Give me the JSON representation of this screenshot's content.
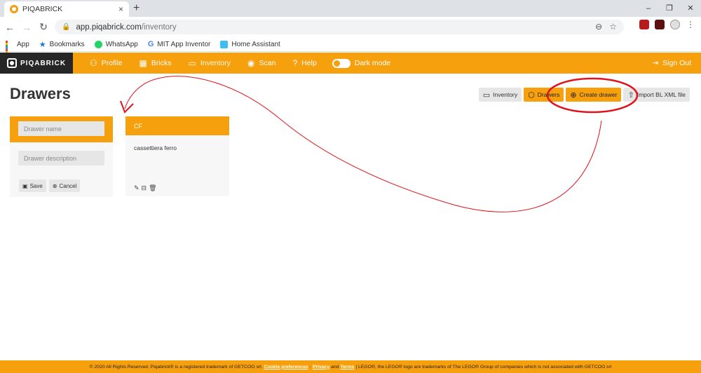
{
  "browser": {
    "tab_title": "PIQABRICK",
    "tab_close": "×",
    "new_tab": "+",
    "window_controls": [
      "–",
      "❐",
      "✕"
    ],
    "url_host": "app.piqabrick.com",
    "url_path": "/inventory",
    "bookmarks": [
      {
        "label": "App",
        "icon": "apps-grid-icon"
      },
      {
        "label": "Bookmarks",
        "icon": "star-icon"
      },
      {
        "label": "WhatsApp",
        "icon": "whatsapp-icon"
      },
      {
        "label": "MIT App Inventor",
        "icon": "google-icon"
      },
      {
        "label": "Home Assistant",
        "icon": "home-assistant-icon"
      }
    ]
  },
  "nav": {
    "brand": "PIQABRICK",
    "items": [
      {
        "label": "Profile",
        "icon": "user-icon",
        "glyph": "⚇"
      },
      {
        "label": "Bricks",
        "icon": "bricks-grid-icon",
        "glyph": "▦"
      },
      {
        "label": "Inventory",
        "icon": "inventory-box-icon",
        "glyph": "▭"
      },
      {
        "label": "Scan",
        "icon": "eye-icon",
        "glyph": "◉"
      },
      {
        "label": "Help",
        "icon": "help-icon",
        "glyph": "?"
      }
    ],
    "dark_mode_label": "Dark mode",
    "sign_out": "Sign Out"
  },
  "page": {
    "title": "Drawers",
    "actions": [
      {
        "label": "Inventory",
        "icon": "inventory-box-icon",
        "style": "grey"
      },
      {
        "label": "Drawers",
        "icon": "cube-icon",
        "style": "orange"
      },
      {
        "label": "Create drawer",
        "icon": "plus-circle-icon",
        "style": "orange"
      },
      {
        "label": "Import BL XML file",
        "icon": "upload-icon",
        "style": "grey"
      }
    ]
  },
  "form": {
    "name_placeholder": "Drawer name",
    "description_placeholder": "Drawer description",
    "save_label": "Save",
    "cancel_label": "Cancel"
  },
  "drawers": [
    {
      "name": "CF",
      "description": "cassettiera ferro"
    }
  ],
  "footer": {
    "prefix": "© 2020 All Rights Reserved. Piqabrick® is a registered trademark of GETCOO srl.",
    "cookie": "Cookie preferences",
    "privacy": "Privacy",
    "and": "and",
    "terms": "Terms",
    "suffix": "| LEGO®, the LEGO® logo are trademarks of The LEGO® Group of companies which is not associated with GETCOO srl"
  },
  "colors": {
    "accent": "#f7a00d",
    "annotation": "#e0141e"
  }
}
